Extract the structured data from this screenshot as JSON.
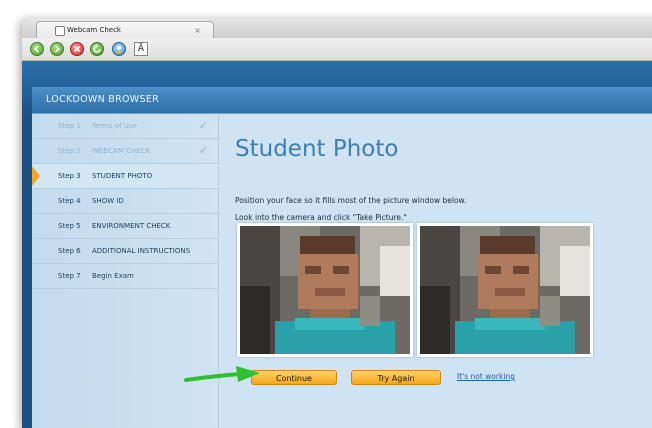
{
  "tab": {
    "title": "Webcam Check",
    "close": "×"
  },
  "toolbar": {
    "font_glyph": "Ā"
  },
  "brand": {
    "title": "LOCKDOWN BROWSER"
  },
  "steps": [
    {
      "num": "Step 1",
      "label": "Terms of Use",
      "state": "done",
      "check": "✓"
    },
    {
      "num": "Step 2",
      "label": "WEBCAM CHECK",
      "state": "done",
      "check": "✓"
    },
    {
      "num": "Step 3",
      "label": "STUDENT PHOTO",
      "state": "active"
    },
    {
      "num": "Step 4",
      "label": "SHOW ID",
      "state": "pending"
    },
    {
      "num": "Step 5",
      "label": "ENVIRONMENT CHECK",
      "state": "pending"
    },
    {
      "num": "Step 6",
      "label": "ADDITIONAL INSTRUCTIONS",
      "state": "pending"
    },
    {
      "num": "Step 7",
      "label": "Begin Exam",
      "state": "pending"
    }
  ],
  "main": {
    "title": "Student Photo",
    "instruction1": "Position your face so it fills most of the picture window below.",
    "instruction2": "Look into the camera and click \"Take Picture.\""
  },
  "buttons": {
    "continue": "Continue",
    "try_again": "Try Again",
    "not_working": "It's not working"
  },
  "colors": {
    "accent": "#f3a71a",
    "title_blue": "#3e7fb3",
    "arrow_green": "#2fbf2f"
  }
}
